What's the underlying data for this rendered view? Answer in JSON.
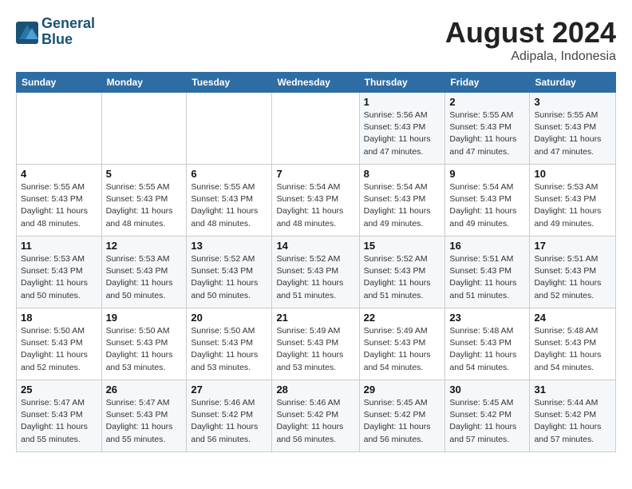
{
  "header": {
    "logo_line1": "General",
    "logo_line2": "Blue",
    "month_title": "August 2024",
    "location": "Adipala, Indonesia"
  },
  "weekdays": [
    "Sunday",
    "Monday",
    "Tuesday",
    "Wednesday",
    "Thursday",
    "Friday",
    "Saturday"
  ],
  "weeks": [
    [
      {
        "day": "",
        "sunrise": "",
        "sunset": "",
        "daylight": ""
      },
      {
        "day": "",
        "sunrise": "",
        "sunset": "",
        "daylight": ""
      },
      {
        "day": "",
        "sunrise": "",
        "sunset": "",
        "daylight": ""
      },
      {
        "day": "",
        "sunrise": "",
        "sunset": "",
        "daylight": ""
      },
      {
        "day": "1",
        "sunrise": "Sunrise: 5:56 AM",
        "sunset": "Sunset: 5:43 PM",
        "daylight": "Daylight: 11 hours and 47 minutes."
      },
      {
        "day": "2",
        "sunrise": "Sunrise: 5:55 AM",
        "sunset": "Sunset: 5:43 PM",
        "daylight": "Daylight: 11 hours and 47 minutes."
      },
      {
        "day": "3",
        "sunrise": "Sunrise: 5:55 AM",
        "sunset": "Sunset: 5:43 PM",
        "daylight": "Daylight: 11 hours and 47 minutes."
      }
    ],
    [
      {
        "day": "4",
        "sunrise": "Sunrise: 5:55 AM",
        "sunset": "Sunset: 5:43 PM",
        "daylight": "Daylight: 11 hours and 48 minutes."
      },
      {
        "day": "5",
        "sunrise": "Sunrise: 5:55 AM",
        "sunset": "Sunset: 5:43 PM",
        "daylight": "Daylight: 11 hours and 48 minutes."
      },
      {
        "day": "6",
        "sunrise": "Sunrise: 5:55 AM",
        "sunset": "Sunset: 5:43 PM",
        "daylight": "Daylight: 11 hours and 48 minutes."
      },
      {
        "day": "7",
        "sunrise": "Sunrise: 5:54 AM",
        "sunset": "Sunset: 5:43 PM",
        "daylight": "Daylight: 11 hours and 48 minutes."
      },
      {
        "day": "8",
        "sunrise": "Sunrise: 5:54 AM",
        "sunset": "Sunset: 5:43 PM",
        "daylight": "Daylight: 11 hours and 49 minutes."
      },
      {
        "day": "9",
        "sunrise": "Sunrise: 5:54 AM",
        "sunset": "Sunset: 5:43 PM",
        "daylight": "Daylight: 11 hours and 49 minutes."
      },
      {
        "day": "10",
        "sunrise": "Sunrise: 5:53 AM",
        "sunset": "Sunset: 5:43 PM",
        "daylight": "Daylight: 11 hours and 49 minutes."
      }
    ],
    [
      {
        "day": "11",
        "sunrise": "Sunrise: 5:53 AM",
        "sunset": "Sunset: 5:43 PM",
        "daylight": "Daylight: 11 hours and 50 minutes."
      },
      {
        "day": "12",
        "sunrise": "Sunrise: 5:53 AM",
        "sunset": "Sunset: 5:43 PM",
        "daylight": "Daylight: 11 hours and 50 minutes."
      },
      {
        "day": "13",
        "sunrise": "Sunrise: 5:52 AM",
        "sunset": "Sunset: 5:43 PM",
        "daylight": "Daylight: 11 hours and 50 minutes."
      },
      {
        "day": "14",
        "sunrise": "Sunrise: 5:52 AM",
        "sunset": "Sunset: 5:43 PM",
        "daylight": "Daylight: 11 hours and 51 minutes."
      },
      {
        "day": "15",
        "sunrise": "Sunrise: 5:52 AM",
        "sunset": "Sunset: 5:43 PM",
        "daylight": "Daylight: 11 hours and 51 minutes."
      },
      {
        "day": "16",
        "sunrise": "Sunrise: 5:51 AM",
        "sunset": "Sunset: 5:43 PM",
        "daylight": "Daylight: 11 hours and 51 minutes."
      },
      {
        "day": "17",
        "sunrise": "Sunrise: 5:51 AM",
        "sunset": "Sunset: 5:43 PM",
        "daylight": "Daylight: 11 hours and 52 minutes."
      }
    ],
    [
      {
        "day": "18",
        "sunrise": "Sunrise: 5:50 AM",
        "sunset": "Sunset: 5:43 PM",
        "daylight": "Daylight: 11 hours and 52 minutes."
      },
      {
        "day": "19",
        "sunrise": "Sunrise: 5:50 AM",
        "sunset": "Sunset: 5:43 PM",
        "daylight": "Daylight: 11 hours and 53 minutes."
      },
      {
        "day": "20",
        "sunrise": "Sunrise: 5:50 AM",
        "sunset": "Sunset: 5:43 PM",
        "daylight": "Daylight: 11 hours and 53 minutes."
      },
      {
        "day": "21",
        "sunrise": "Sunrise: 5:49 AM",
        "sunset": "Sunset: 5:43 PM",
        "daylight": "Daylight: 11 hours and 53 minutes."
      },
      {
        "day": "22",
        "sunrise": "Sunrise: 5:49 AM",
        "sunset": "Sunset: 5:43 PM",
        "daylight": "Daylight: 11 hours and 54 minutes."
      },
      {
        "day": "23",
        "sunrise": "Sunrise: 5:48 AM",
        "sunset": "Sunset: 5:43 PM",
        "daylight": "Daylight: 11 hours and 54 minutes."
      },
      {
        "day": "24",
        "sunrise": "Sunrise: 5:48 AM",
        "sunset": "Sunset: 5:43 PM",
        "daylight": "Daylight: 11 hours and 54 minutes."
      }
    ],
    [
      {
        "day": "25",
        "sunrise": "Sunrise: 5:47 AM",
        "sunset": "Sunset: 5:43 PM",
        "daylight": "Daylight: 11 hours and 55 minutes."
      },
      {
        "day": "26",
        "sunrise": "Sunrise: 5:47 AM",
        "sunset": "Sunset: 5:43 PM",
        "daylight": "Daylight: 11 hours and 55 minutes."
      },
      {
        "day": "27",
        "sunrise": "Sunrise: 5:46 AM",
        "sunset": "Sunset: 5:42 PM",
        "daylight": "Daylight: 11 hours and 56 minutes."
      },
      {
        "day": "28",
        "sunrise": "Sunrise: 5:46 AM",
        "sunset": "Sunset: 5:42 PM",
        "daylight": "Daylight: 11 hours and 56 minutes."
      },
      {
        "day": "29",
        "sunrise": "Sunrise: 5:45 AM",
        "sunset": "Sunset: 5:42 PM",
        "daylight": "Daylight: 11 hours and 56 minutes."
      },
      {
        "day": "30",
        "sunrise": "Sunrise: 5:45 AM",
        "sunset": "Sunset: 5:42 PM",
        "daylight": "Daylight: 11 hours and 57 minutes."
      },
      {
        "day": "31",
        "sunrise": "Sunrise: 5:44 AM",
        "sunset": "Sunset: 5:42 PM",
        "daylight": "Daylight: 11 hours and 57 minutes."
      }
    ]
  ]
}
